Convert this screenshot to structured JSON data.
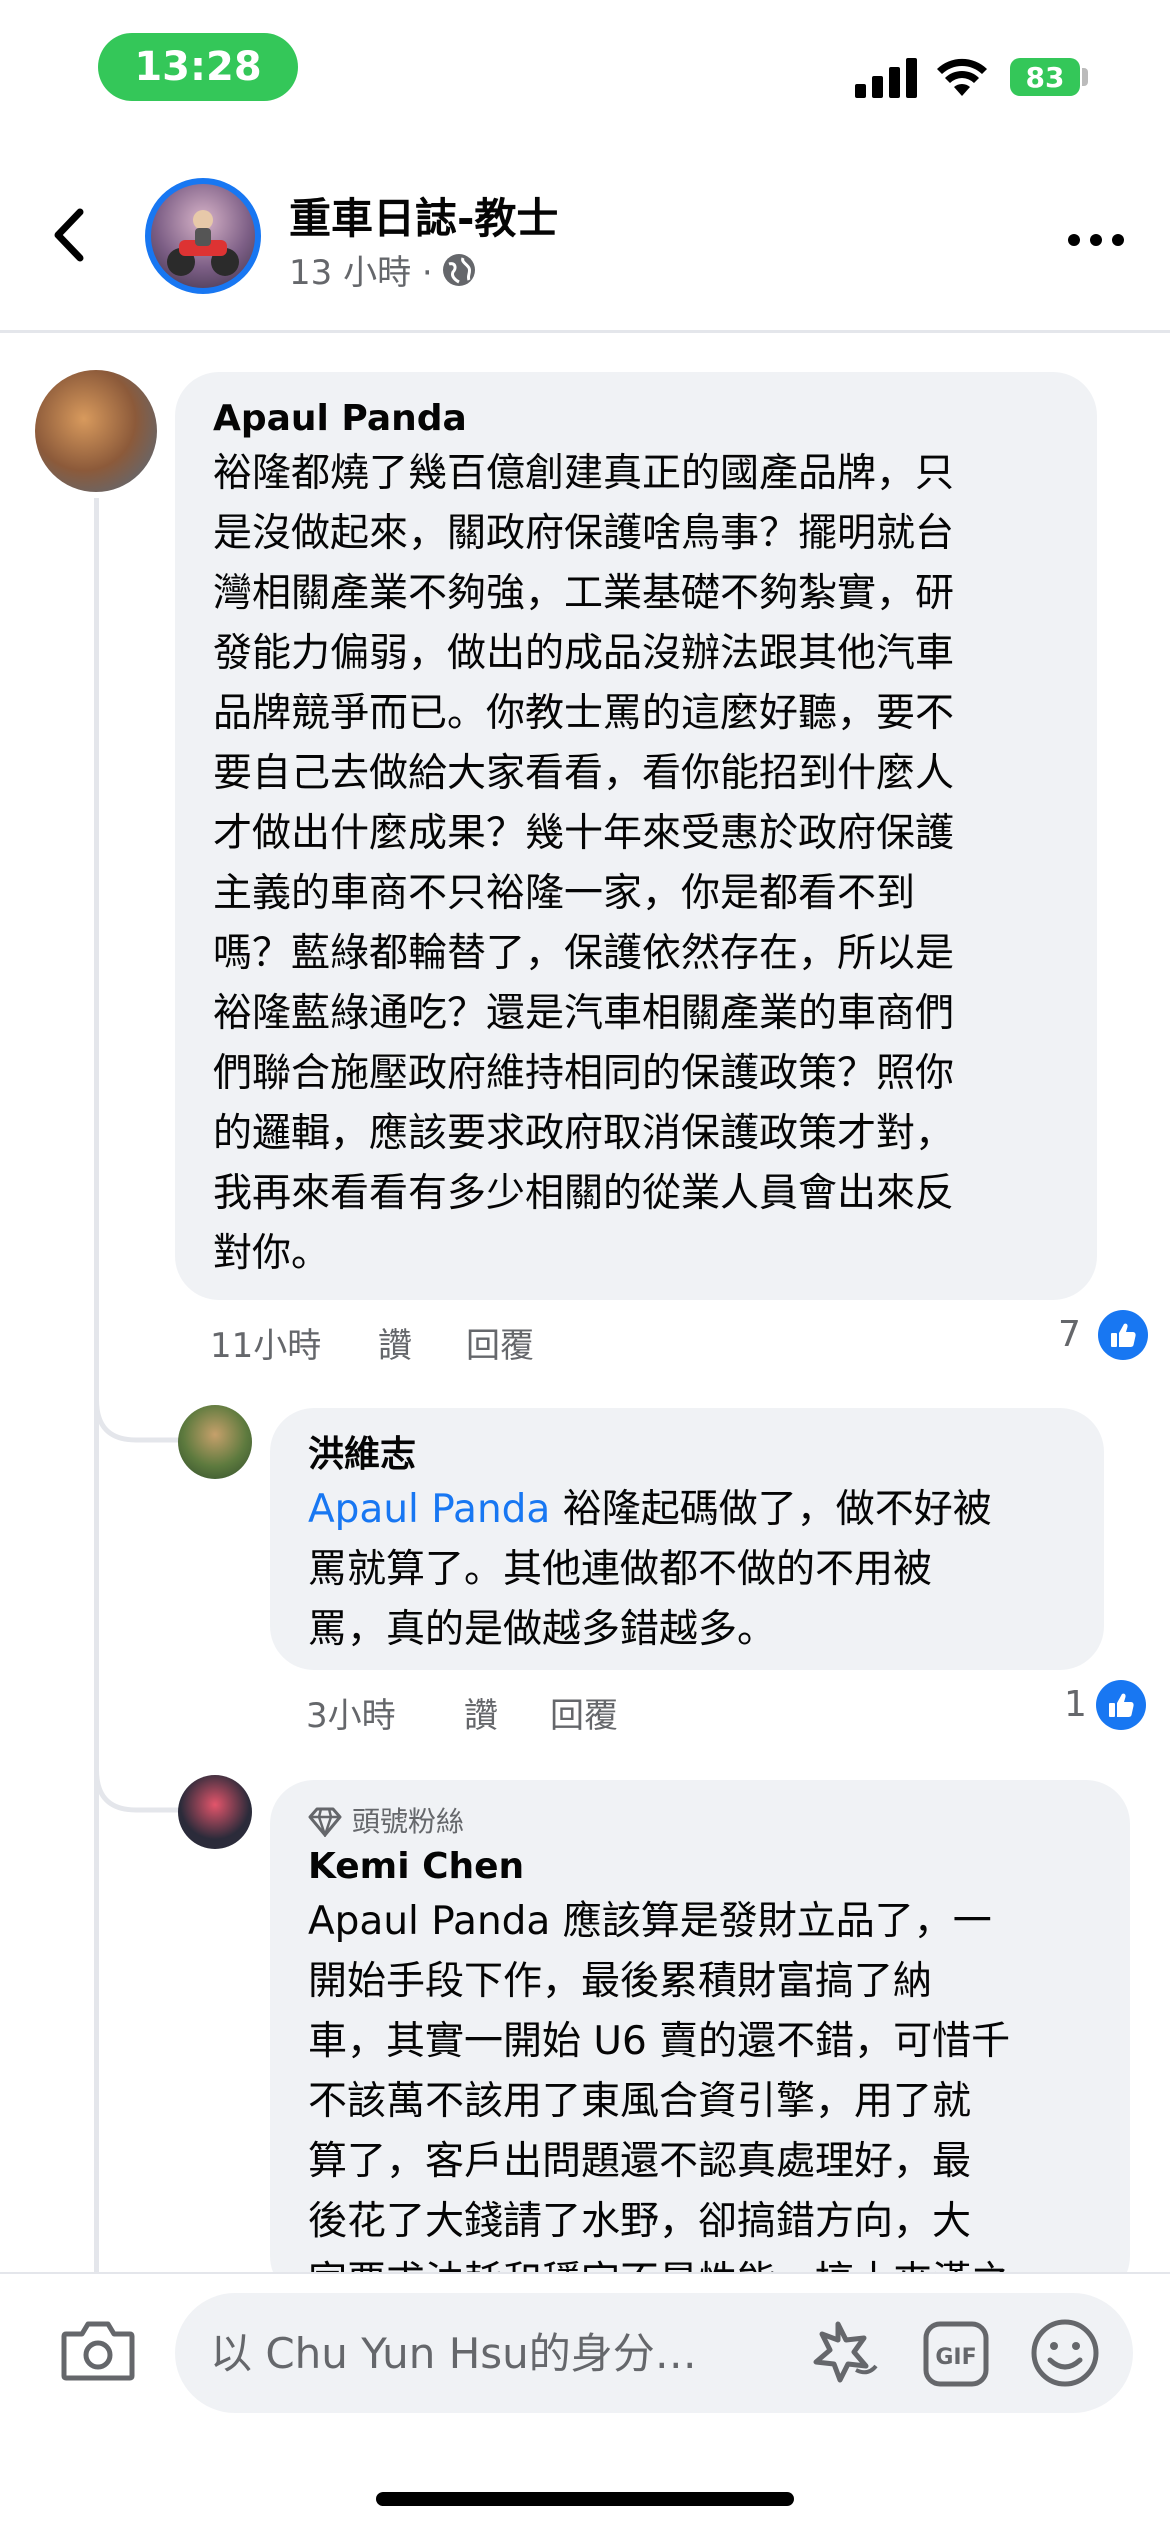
{
  "status_bar": {
    "time": "13:28",
    "battery": "83",
    "accent_color": "#34c759"
  },
  "header": {
    "page_name": "重車日誌-教士",
    "post_time": "13 小時 ·",
    "privacy_icon": "globe-icon"
  },
  "comments": [
    {
      "author": "Apaul Panda",
      "lines": [
        "裕隆都燒了幾百億創建真正的國產品牌，只",
        "是沒做起來，關政府保護啥鳥事？擺明就台",
        "灣相關產業不夠強，工業基礎不夠紮實，研",
        "發能力偏弱，做出的成品沒辦法跟其他汽車",
        "品牌競爭而已。你教士罵的這麼好聽，要不",
        "要自己去做給大家看看，看你能招到什麼人",
        "才做出什麼成果？幾十年來受惠於政府保護",
        "主義的車商不只裕隆一家，你是都看不到",
        "嗎？藍綠都輪替了，保護依然存在，所以是",
        "裕隆藍綠通吃？還是汽車相關產業的車商們",
        "們聯合施壓政府維持相同的保護政策？照你",
        "的邏輯，應該要求政府取消保護政策才對，",
        "我再來看看有多少相關的從業人員會出來反",
        "對你。"
      ],
      "time": "11小時",
      "like_label": "讚",
      "reply_label": "回覆",
      "reaction_count": "7"
    },
    {
      "author": "洪維志",
      "mention": "Apaul Panda",
      "first_line_rest": " 裕隆起碼做了，做不好被",
      "lines": [
        "罵就算了。其他連做都不做的不用被",
        "罵，真的是做越多錯越多。"
      ],
      "time": "3小時",
      "like_label": "讚",
      "reply_label": "回覆",
      "reaction_count": "1"
    },
    {
      "badge": "頭號粉絲",
      "author": "Kemi Chen",
      "lines": [
        "Apaul Panda 應該算是發財立品了，一",
        "開始手段下作，最後累積財富搞了納",
        "車，其實一開始 U6 賣的還不錯，可惜千",
        "不該萬不該用了東風合資引擎，用了就",
        "算了，客戶出問題還不認真處理好，最",
        "後花了大錢請了水野，卻搞錯方向，大",
        "家要求油耗和穩定不是性能，搞十來漢之"
      ]
    }
  ],
  "composer": {
    "placeholder": "以 Chu Yun Hsu的身分…"
  },
  "colors": {
    "brand_blue": "#1877f2",
    "bubble_bg": "#f0f2f5",
    "secondary_text": "#65676b"
  }
}
